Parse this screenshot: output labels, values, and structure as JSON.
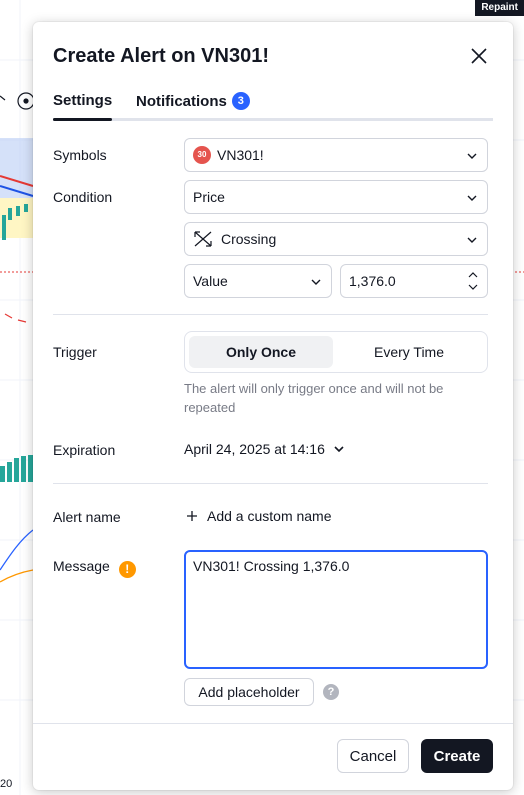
{
  "background": {
    "badge": "Repaint",
    "x_axis_label": "20"
  },
  "dialog": {
    "title": "Create Alert on VN301!",
    "close_icon": "close-icon",
    "tabs": [
      {
        "label": "Settings",
        "active": true
      },
      {
        "label": "Notifications",
        "badge": "3",
        "active": false
      }
    ],
    "symbols": {
      "label": "Symbols",
      "logo_text": "30",
      "value": "VN301!"
    },
    "condition": {
      "label": "Condition",
      "source": "Price",
      "operator": "Crossing",
      "operator_icon": "crossing-icon",
      "target_type": "Value",
      "target_value": "1,376.0"
    },
    "trigger": {
      "label": "Trigger",
      "options": [
        "Only Once",
        "Every Time"
      ],
      "selected": "Only Once",
      "hint": "The alert will only trigger once and will not be repeated"
    },
    "expiration": {
      "label": "Expiration",
      "value": "April 24, 2025 at 14:16"
    },
    "alert_name": {
      "label": "Alert name",
      "action": "Add a custom name"
    },
    "message": {
      "label": "Message",
      "warning_icon": "!",
      "value": "VN301! Crossing 1,376.0",
      "placeholder_button": "Add placeholder",
      "help_icon": "?"
    },
    "footer": {
      "cancel": "Cancel",
      "create": "Create"
    }
  },
  "colors": {
    "accent": "#2962ff",
    "primary_button": "#131722",
    "warning": "#ff9800",
    "symbol_logo": "#e5544e"
  }
}
